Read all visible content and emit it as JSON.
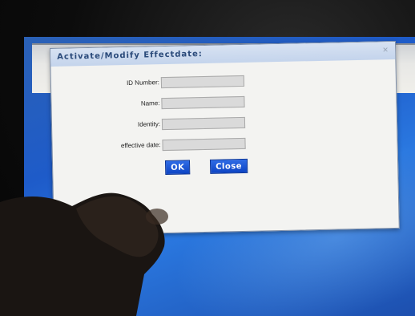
{
  "dialog": {
    "title": "Activate/Modify Effectdate:",
    "close_icon": "close-icon",
    "fields": [
      {
        "label": "ID Number:",
        "value": ""
      },
      {
        "label": "Name:",
        "value": ""
      },
      {
        "label": "Identity:",
        "value": ""
      },
      {
        "label": "effective date:",
        "value": ""
      }
    ],
    "ok_label": "OK",
    "close_label": "Close"
  }
}
